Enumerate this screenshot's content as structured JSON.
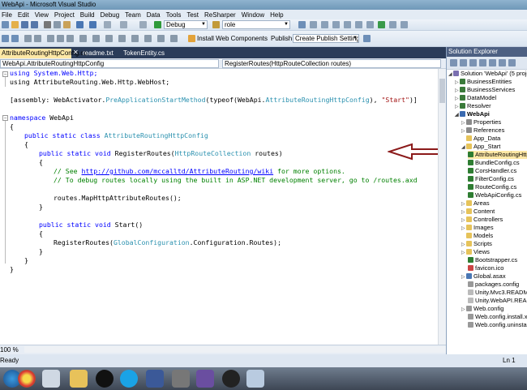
{
  "window": {
    "title": "WebApi - Microsoft Visual Studio"
  },
  "menu": [
    "File",
    "Edit",
    "View",
    "Project",
    "Build",
    "Debug",
    "Team",
    "Data",
    "Tools",
    "Test",
    "ReSharper",
    "Window",
    "Help"
  ],
  "toolbar": {
    "config_combo": "Debug",
    "find_combo": "role",
    "install_web_components": "Install Web Components",
    "publish_label": "Publish:",
    "publish_combo": "Create Publish Settings"
  },
  "tabs": [
    "AttributeRoutingHttpConfig.cs",
    "readme.txt",
    "TokenEntity.cs"
  ],
  "navbar": {
    "left": "WebApi.AttributeRoutingHttpConfig",
    "right": "RegisterRoutes(HttpRouteCollection routes)"
  },
  "code": {
    "l1": "using System.Web.Http;",
    "l2": "using AttributeRouting.Web.Http.WebHost;",
    "l3a": "[assembly: WebActivator.",
    "l3b": "PreApplicationStartMethod",
    "l3c": "(typeof(WebApi.",
    "l3d": "AttributeRoutingHttpConfig",
    "l3e": "), ",
    "l3f": "\"Start\"",
    "l3g": ")]",
    "l4a": "namespace",
    "l4b": " WebApi",
    "l5": "{",
    "l6a": "public static class ",
    "l6b": "AttributeRoutingHttpConfig",
    "l7": "{",
    "l8a": "public static void ",
    "l8b": "RegisterRoutes(",
    "l8c": "HttpRouteCollection",
    "l8d": " routes)",
    "l9": "{",
    "l10a": "// See ",
    "l10b": "http://github.com/mccalltd/AttributeRouting/wiki",
    "l10c": " for more options.",
    "l11": "// To debug routes locally using the built in ASP.NET development server, go to /routes.axd",
    "l12": "routes.MapHttpAttributeRoutes();",
    "l13": "}",
    "l14a": "public static void ",
    "l14b": "Start()",
    "l15": "{",
    "l16a": "RegisterRoutes(",
    "l16b": "GlobalConfiguration",
    "l16c": ".Configuration.Routes);",
    "l17": "}",
    "l18": "}",
    "l19": "}"
  },
  "zoom": "100 %",
  "status": {
    "left": "Ready",
    "right": "Ln 1"
  },
  "solution_explorer": {
    "title": "Solution Explorer",
    "items": [
      "Solution 'WebApi' (5 projects)",
      "BusinessEntities",
      "BusinessServices",
      "DataModel",
      "Resolver",
      "WebApi",
      "Properties",
      "References",
      "App_Data",
      "App_Start",
      "AttributeRoutingHttpConfig.cs",
      "BundleConfig.cs",
      "CorsHandler.cs",
      "FilterConfig.cs",
      "RouteConfig.cs",
      "WebApiConfig.cs",
      "Areas",
      "Content",
      "Controllers",
      "Images",
      "Models",
      "Scripts",
      "Views",
      "Bootstrapper.cs",
      "favicon.ico",
      "Global.asax",
      "packages.config",
      "Unity.Mvc3.README.txt",
      "Unity.WebAPI.README.txt",
      "Web.config",
      "Web.config.install.xdt",
      "Web.config.uninstall.xdt"
    ]
  },
  "colors": {
    "arrow": "#8b1a1a",
    "tab_active": "#ffe8a6",
    "tab_strip": "#2b3c59"
  }
}
